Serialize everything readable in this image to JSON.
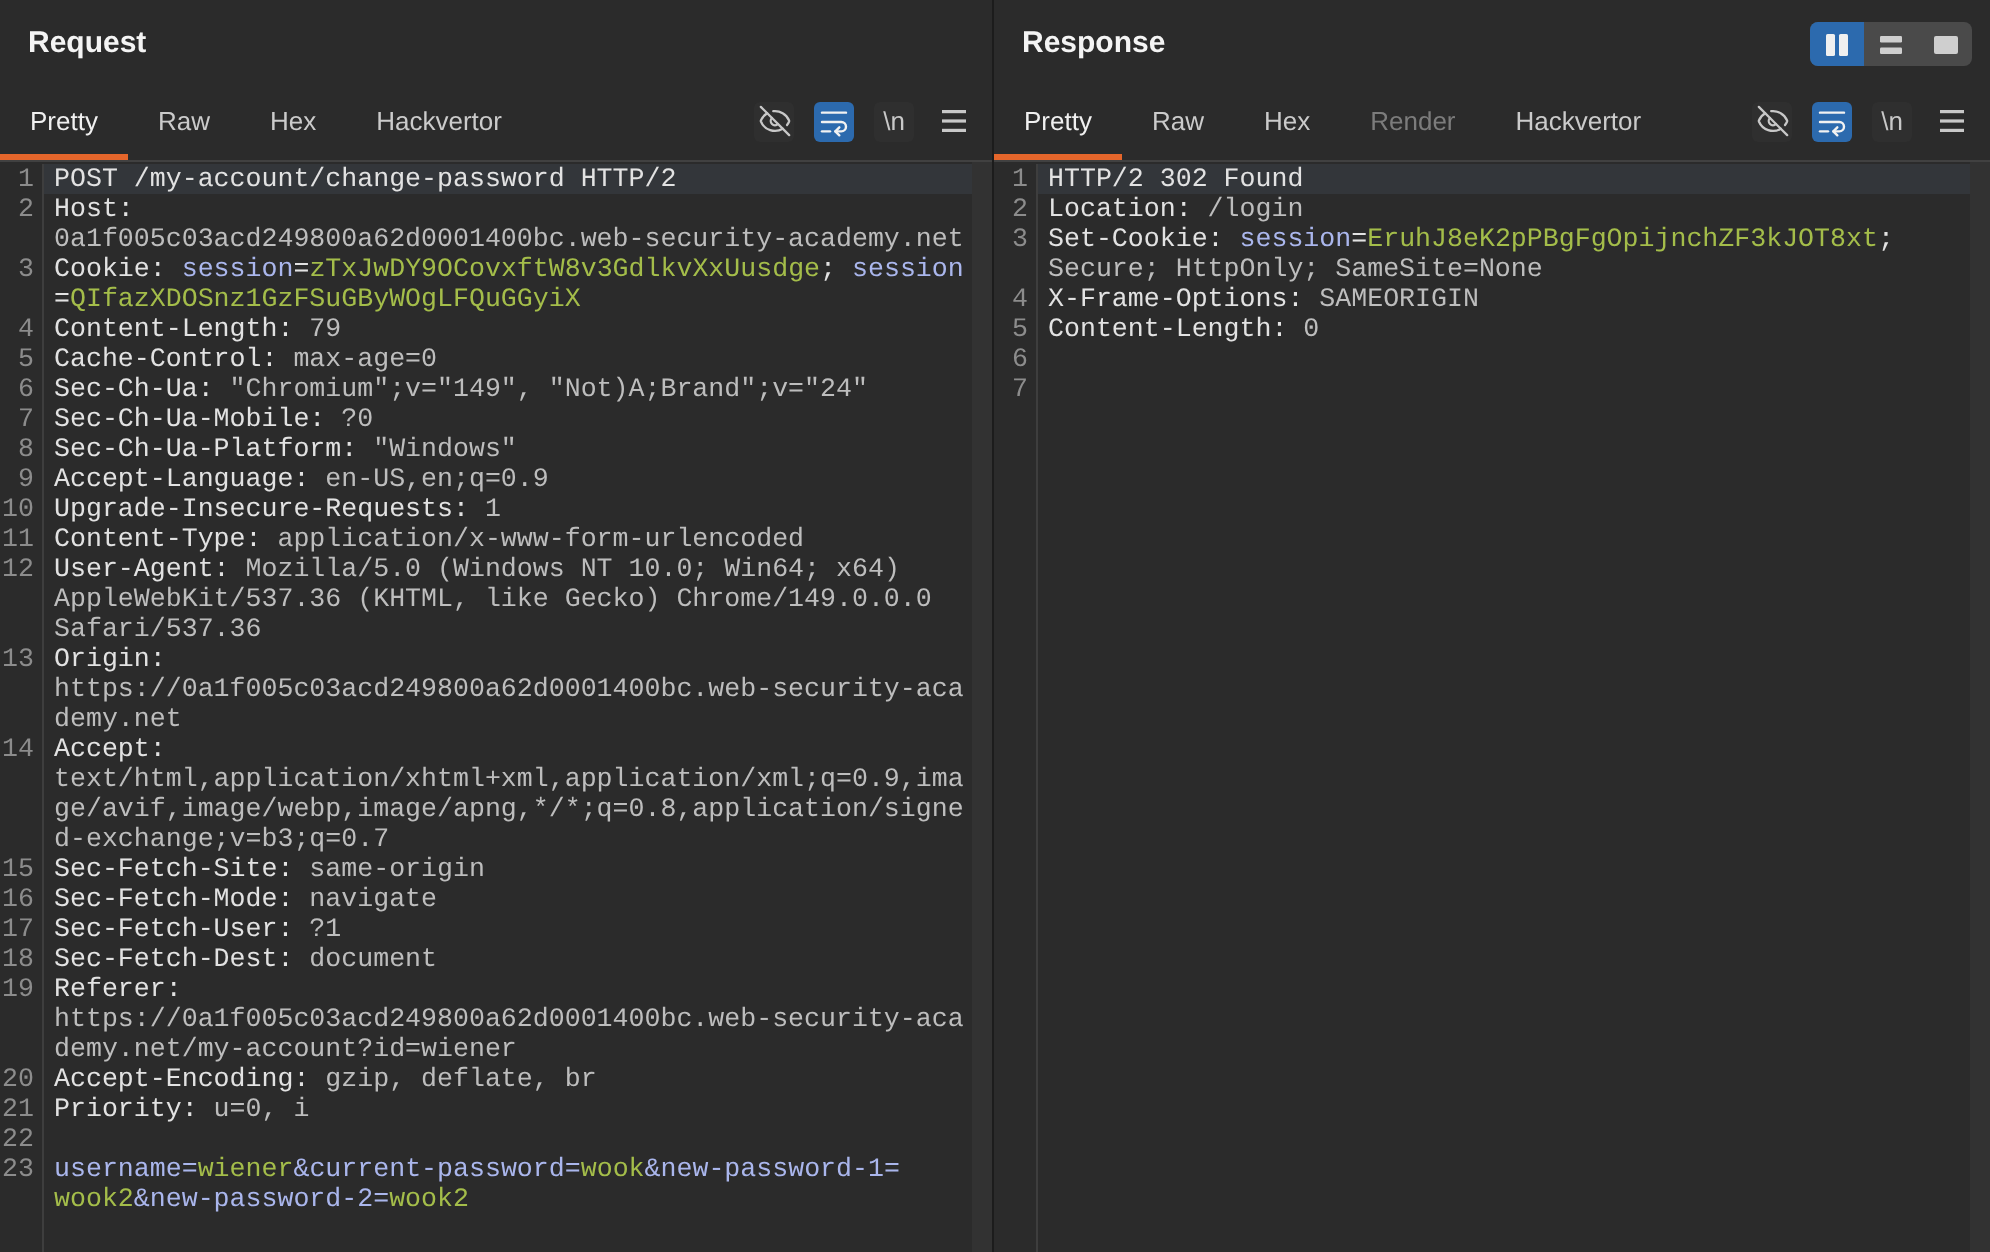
{
  "request": {
    "title": "Request",
    "tabs": [
      {
        "label": "Pretty",
        "selected": true,
        "disabled": false
      },
      {
        "label": "Raw",
        "selected": false,
        "disabled": false
      },
      {
        "label": "Hex",
        "selected": false,
        "disabled": false
      },
      {
        "label": "Hackvertor",
        "selected": false,
        "disabled": false
      }
    ],
    "toggles": [
      {
        "kind": "hide",
        "on": false
      },
      {
        "kind": "wrap",
        "on": true
      },
      {
        "kind": "newline",
        "label": "\\n",
        "on": false
      }
    ],
    "lines": [
      {
        "number": "1",
        "current": true,
        "rows": [
          [
            {
              "kind": "start",
              "text": "POST /my-account/change-password HTTP/2"
            }
          ]
        ]
      },
      {
        "number": "2",
        "current": false,
        "rows": [
          [
            {
              "kind": "name",
              "text": "Host: "
            }
          ],
          [
            {
              "kind": "value",
              "text": "0a1f005c03acd249800a62d0001400bc.web-security-academy.net"
            }
          ]
        ]
      },
      {
        "number": "3",
        "current": false,
        "rows": [
          [
            {
              "kind": "name",
              "text": "Cookie: "
            },
            {
              "kind": "param",
              "text": "session"
            },
            {
              "kind": "name",
              "text": "="
            },
            {
              "kind": "param_value",
              "text": "zTxJwDY9OCovxftW8v3GdlkvXxUusdge"
            },
            {
              "kind": "name",
              "text": "; "
            },
            {
              "kind": "param",
              "text": "session"
            }
          ],
          [
            {
              "kind": "name",
              "text": "="
            },
            {
              "kind": "param_value",
              "text": "QIfazXDOSnz1GzFSuGByWOgLFQuGGyiX"
            }
          ]
        ]
      },
      {
        "number": "4",
        "current": false,
        "rows": [
          [
            {
              "kind": "name",
              "text": "Content-Length:"
            },
            {
              "kind": "value",
              "text": " 79"
            }
          ]
        ]
      },
      {
        "number": "5",
        "current": false,
        "rows": [
          [
            {
              "kind": "name",
              "text": "Cache-Control:"
            },
            {
              "kind": "value",
              "text": " max-age=0"
            }
          ]
        ]
      },
      {
        "number": "6",
        "current": false,
        "rows": [
          [
            {
              "kind": "name",
              "text": "Sec-Ch-Ua:"
            },
            {
              "kind": "value",
              "text": " \"Chromium\";v=\"149\", \"Not)A;Brand\";v=\"24\""
            }
          ]
        ]
      },
      {
        "number": "7",
        "current": false,
        "rows": [
          [
            {
              "kind": "name",
              "text": "Sec-Ch-Ua-Mobile:"
            },
            {
              "kind": "value",
              "text": " ?0"
            }
          ]
        ]
      },
      {
        "number": "8",
        "current": false,
        "rows": [
          [
            {
              "kind": "name",
              "text": "Sec-Ch-Ua-Platform:"
            },
            {
              "kind": "value",
              "text": " \"Windows\""
            }
          ]
        ]
      },
      {
        "number": "9",
        "current": false,
        "rows": [
          [
            {
              "kind": "name",
              "text": "Accept-Language:"
            },
            {
              "kind": "value",
              "text": " en-US,en;q=0.9"
            }
          ]
        ]
      },
      {
        "number": "10",
        "current": false,
        "rows": [
          [
            {
              "kind": "name",
              "text": "Upgrade-Insecure-Requests:"
            },
            {
              "kind": "value",
              "text": " 1"
            }
          ]
        ]
      },
      {
        "number": "11",
        "current": false,
        "rows": [
          [
            {
              "kind": "name",
              "text": "Content-Type:"
            },
            {
              "kind": "value",
              "text": " application/x-www-form-urlencoded"
            }
          ]
        ]
      },
      {
        "number": "12",
        "current": false,
        "rows": [
          [
            {
              "kind": "name",
              "text": "User-Agent:"
            },
            {
              "kind": "value",
              "text": " Mozilla/5.0 (Windows NT 10.0; Win64; x64) "
            }
          ],
          [
            {
              "kind": "value",
              "text": "AppleWebKit/537.36 (KHTML, like Gecko) Chrome/149.0.0.0 "
            }
          ],
          [
            {
              "kind": "value",
              "text": "Safari/537.36"
            }
          ]
        ]
      },
      {
        "number": "13",
        "current": false,
        "rows": [
          [
            {
              "kind": "name",
              "text": "Origin: "
            }
          ],
          [
            {
              "kind": "value",
              "text": "https://0a1f005c03acd249800a62d0001400bc.web-security-aca"
            }
          ],
          [
            {
              "kind": "value",
              "text": "demy.net"
            }
          ]
        ]
      },
      {
        "number": "14",
        "current": false,
        "rows": [
          [
            {
              "kind": "name",
              "text": "Accept: "
            }
          ],
          [
            {
              "kind": "value",
              "text": "text/html,application/xhtml+xml,application/xml;q=0.9,ima"
            }
          ],
          [
            {
              "kind": "value",
              "text": "ge/avif,image/webp,image/apng,*/*;q=0.8,application/signe"
            }
          ],
          [
            {
              "kind": "value",
              "text": "d-exchange;v=b3;q=0.7"
            }
          ]
        ]
      },
      {
        "number": "15",
        "current": false,
        "rows": [
          [
            {
              "kind": "name",
              "text": "Sec-Fetch-Site:"
            },
            {
              "kind": "value",
              "text": " same-origin"
            }
          ]
        ]
      },
      {
        "number": "16",
        "current": false,
        "rows": [
          [
            {
              "kind": "name",
              "text": "Sec-Fetch-Mode:"
            },
            {
              "kind": "value",
              "text": " navigate"
            }
          ]
        ]
      },
      {
        "number": "17",
        "current": false,
        "rows": [
          [
            {
              "kind": "name",
              "text": "Sec-Fetch-User:"
            },
            {
              "kind": "value",
              "text": " ?1"
            }
          ]
        ]
      },
      {
        "number": "18",
        "current": false,
        "rows": [
          [
            {
              "kind": "name",
              "text": "Sec-Fetch-Dest:"
            },
            {
              "kind": "value",
              "text": " document"
            }
          ]
        ]
      },
      {
        "number": "19",
        "current": false,
        "rows": [
          [
            {
              "kind": "name",
              "text": "Referer: "
            }
          ],
          [
            {
              "kind": "value",
              "text": "https://0a1f005c03acd249800a62d0001400bc.web-security-aca"
            }
          ],
          [
            {
              "kind": "value",
              "text": "demy.net/my-account?id=wiener"
            }
          ]
        ]
      },
      {
        "number": "20",
        "current": false,
        "rows": [
          [
            {
              "kind": "name",
              "text": "Accept-Encoding:"
            },
            {
              "kind": "value",
              "text": " gzip, deflate, br"
            }
          ]
        ]
      },
      {
        "number": "21",
        "current": false,
        "rows": [
          [
            {
              "kind": "name",
              "text": "Priority:"
            },
            {
              "kind": "value",
              "text": " u=0, i"
            }
          ]
        ]
      },
      {
        "number": "22",
        "current": false
      },
      {
        "number": "23",
        "current": false,
        "rows": [
          [
            {
              "kind": "param",
              "text": "username="
            },
            {
              "kind": "param_value",
              "text": "wiener"
            },
            {
              "kind": "param",
              "text": "&current-password="
            },
            {
              "kind": "param_value",
              "text": "wook"
            },
            {
              "kind": "param",
              "text": "&new-password-1="
            }
          ],
          [
            {
              "kind": "param_value",
              "text": "wook2"
            },
            {
              "kind": "param",
              "text": "&new-password-2="
            },
            {
              "kind": "param_value",
              "text": "wook2"
            }
          ]
        ]
      }
    ]
  },
  "response": {
    "title": "Response",
    "layout_switch": [
      {
        "kind": "columns",
        "selected": true
      },
      {
        "kind": "rows",
        "selected": false
      },
      {
        "kind": "single",
        "selected": false
      }
    ],
    "tabs": [
      {
        "label": "Pretty",
        "selected": true,
        "disabled": false
      },
      {
        "label": "Raw",
        "selected": false,
        "disabled": false
      },
      {
        "label": "Hex",
        "selected": false,
        "disabled": false
      },
      {
        "label": "Render",
        "selected": false,
        "disabled": true
      },
      {
        "label": "Hackvertor",
        "selected": false,
        "disabled": false
      }
    ],
    "toggles": [
      {
        "kind": "hide",
        "on": false
      },
      {
        "kind": "wrap",
        "on": true
      },
      {
        "kind": "newline",
        "label": "\\n",
        "on": false
      }
    ],
    "lines": [
      {
        "number": "1",
        "current": true,
        "rows": [
          [
            {
              "kind": "start",
              "text": "HTTP/2 302 Found"
            }
          ]
        ]
      },
      {
        "number": "2",
        "current": false,
        "rows": [
          [
            {
              "kind": "name",
              "text": "Location:"
            },
            {
              "kind": "value",
              "text": " /login"
            }
          ]
        ]
      },
      {
        "number": "3",
        "current": false,
        "rows": [
          [
            {
              "kind": "name",
              "text": "Set-Cookie: "
            },
            {
              "kind": "param",
              "text": "session"
            },
            {
              "kind": "name",
              "text": "="
            },
            {
              "kind": "param_value",
              "text": "EruhJ8eK2pPBgFgOpijnchZF3kJOT8xt"
            },
            {
              "kind": "name",
              "text": "; "
            }
          ],
          [
            {
              "kind": "value",
              "text": "Secure; HttpOnly; SameSite=None"
            }
          ]
        ]
      },
      {
        "number": "4",
        "current": false,
        "rows": [
          [
            {
              "kind": "name",
              "text": "X-Frame-Options:"
            },
            {
              "kind": "value",
              "text": " SAMEORIGIN"
            }
          ]
        ]
      },
      {
        "number": "5",
        "current": false,
        "rows": [
          [
            {
              "kind": "name",
              "text": "Content-Length:"
            },
            {
              "kind": "value",
              "text": " 0"
            }
          ]
        ]
      },
      {
        "number": "6",
        "current": false
      },
      {
        "number": "7",
        "current": false
      }
    ]
  }
}
